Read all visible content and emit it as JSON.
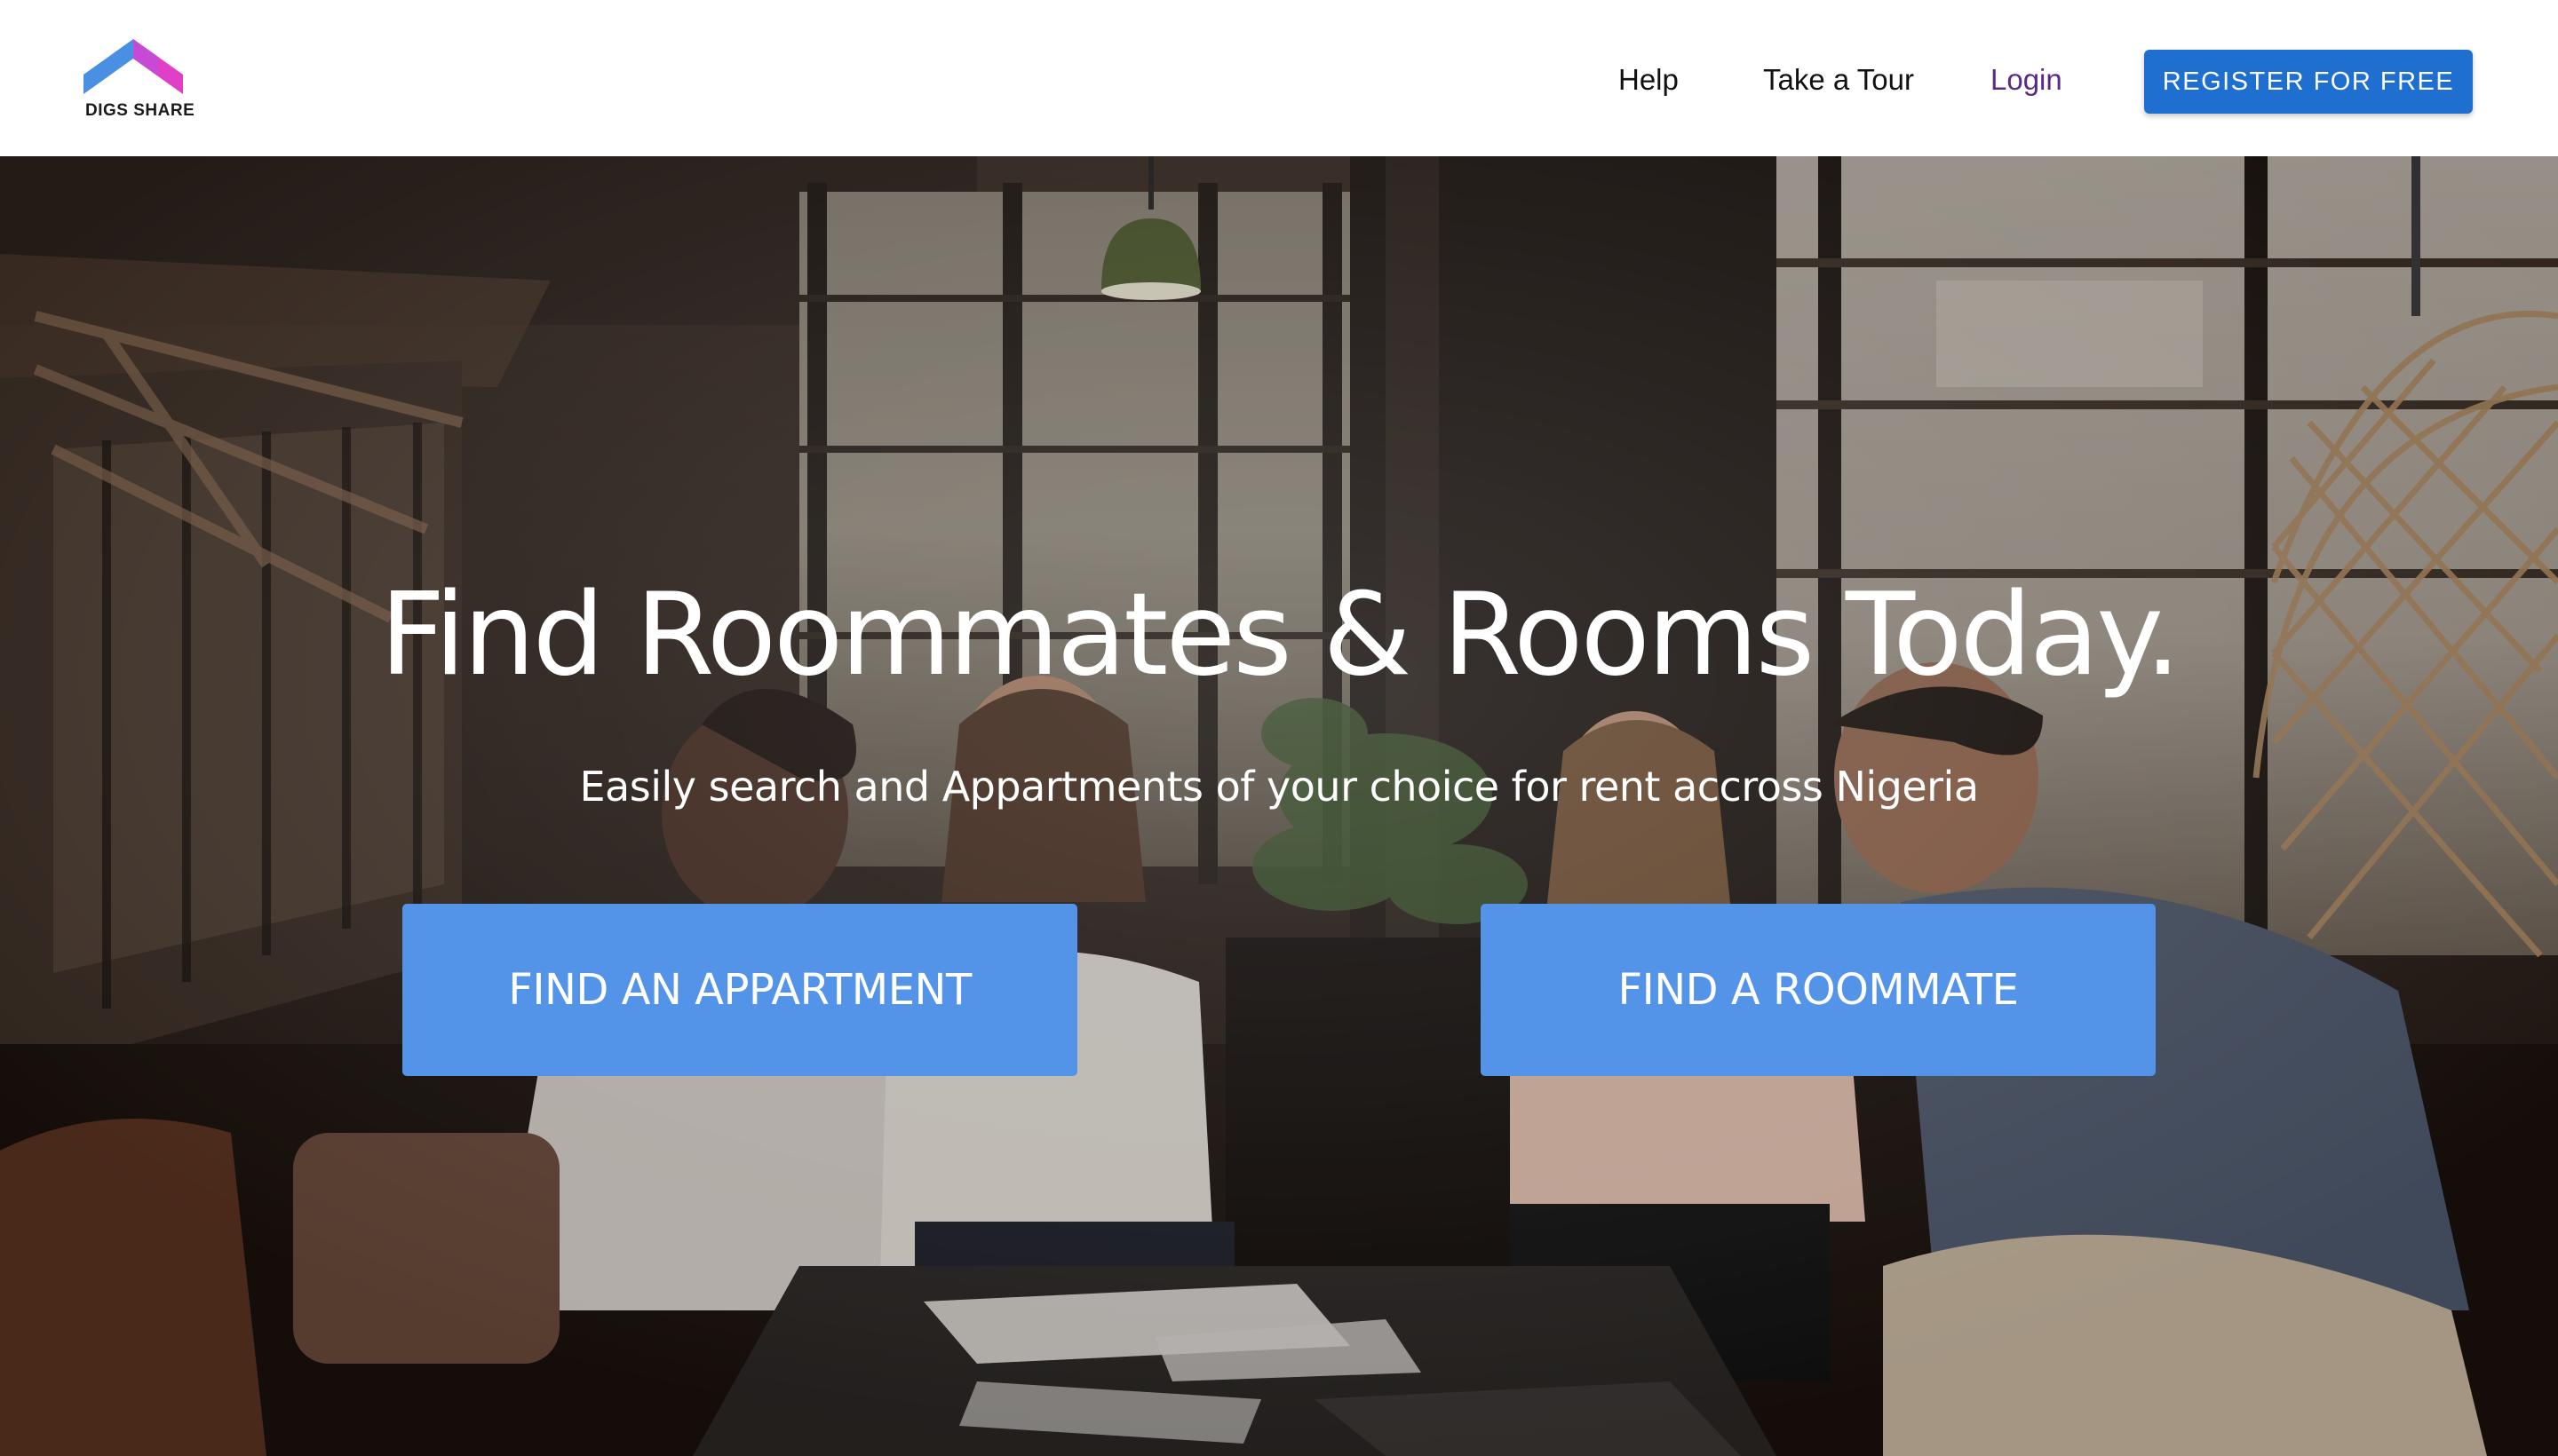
{
  "brand": {
    "name": "DIGS SHARE",
    "logo_icon": "house-roof-icon",
    "colors": {
      "roof_left": "#4a90e2",
      "roof_right": "#e040c8"
    }
  },
  "nav": {
    "help": "Help",
    "tour": "Take a Tour",
    "login": "Login",
    "register": "REGISTER FOR FREE"
  },
  "hero": {
    "title": "Find Roommates & Rooms Today.",
    "subtitle": "Easily search and Appartments of your choice for rent accross Nigeria",
    "buttons": {
      "apartment": "FIND AN APPARTMENT",
      "roommate": "FIND A ROOMMATE"
    }
  },
  "colors": {
    "register_button": "#1f6fd1",
    "cta_button": "#5393e8",
    "login_link": "#5b2a86"
  }
}
